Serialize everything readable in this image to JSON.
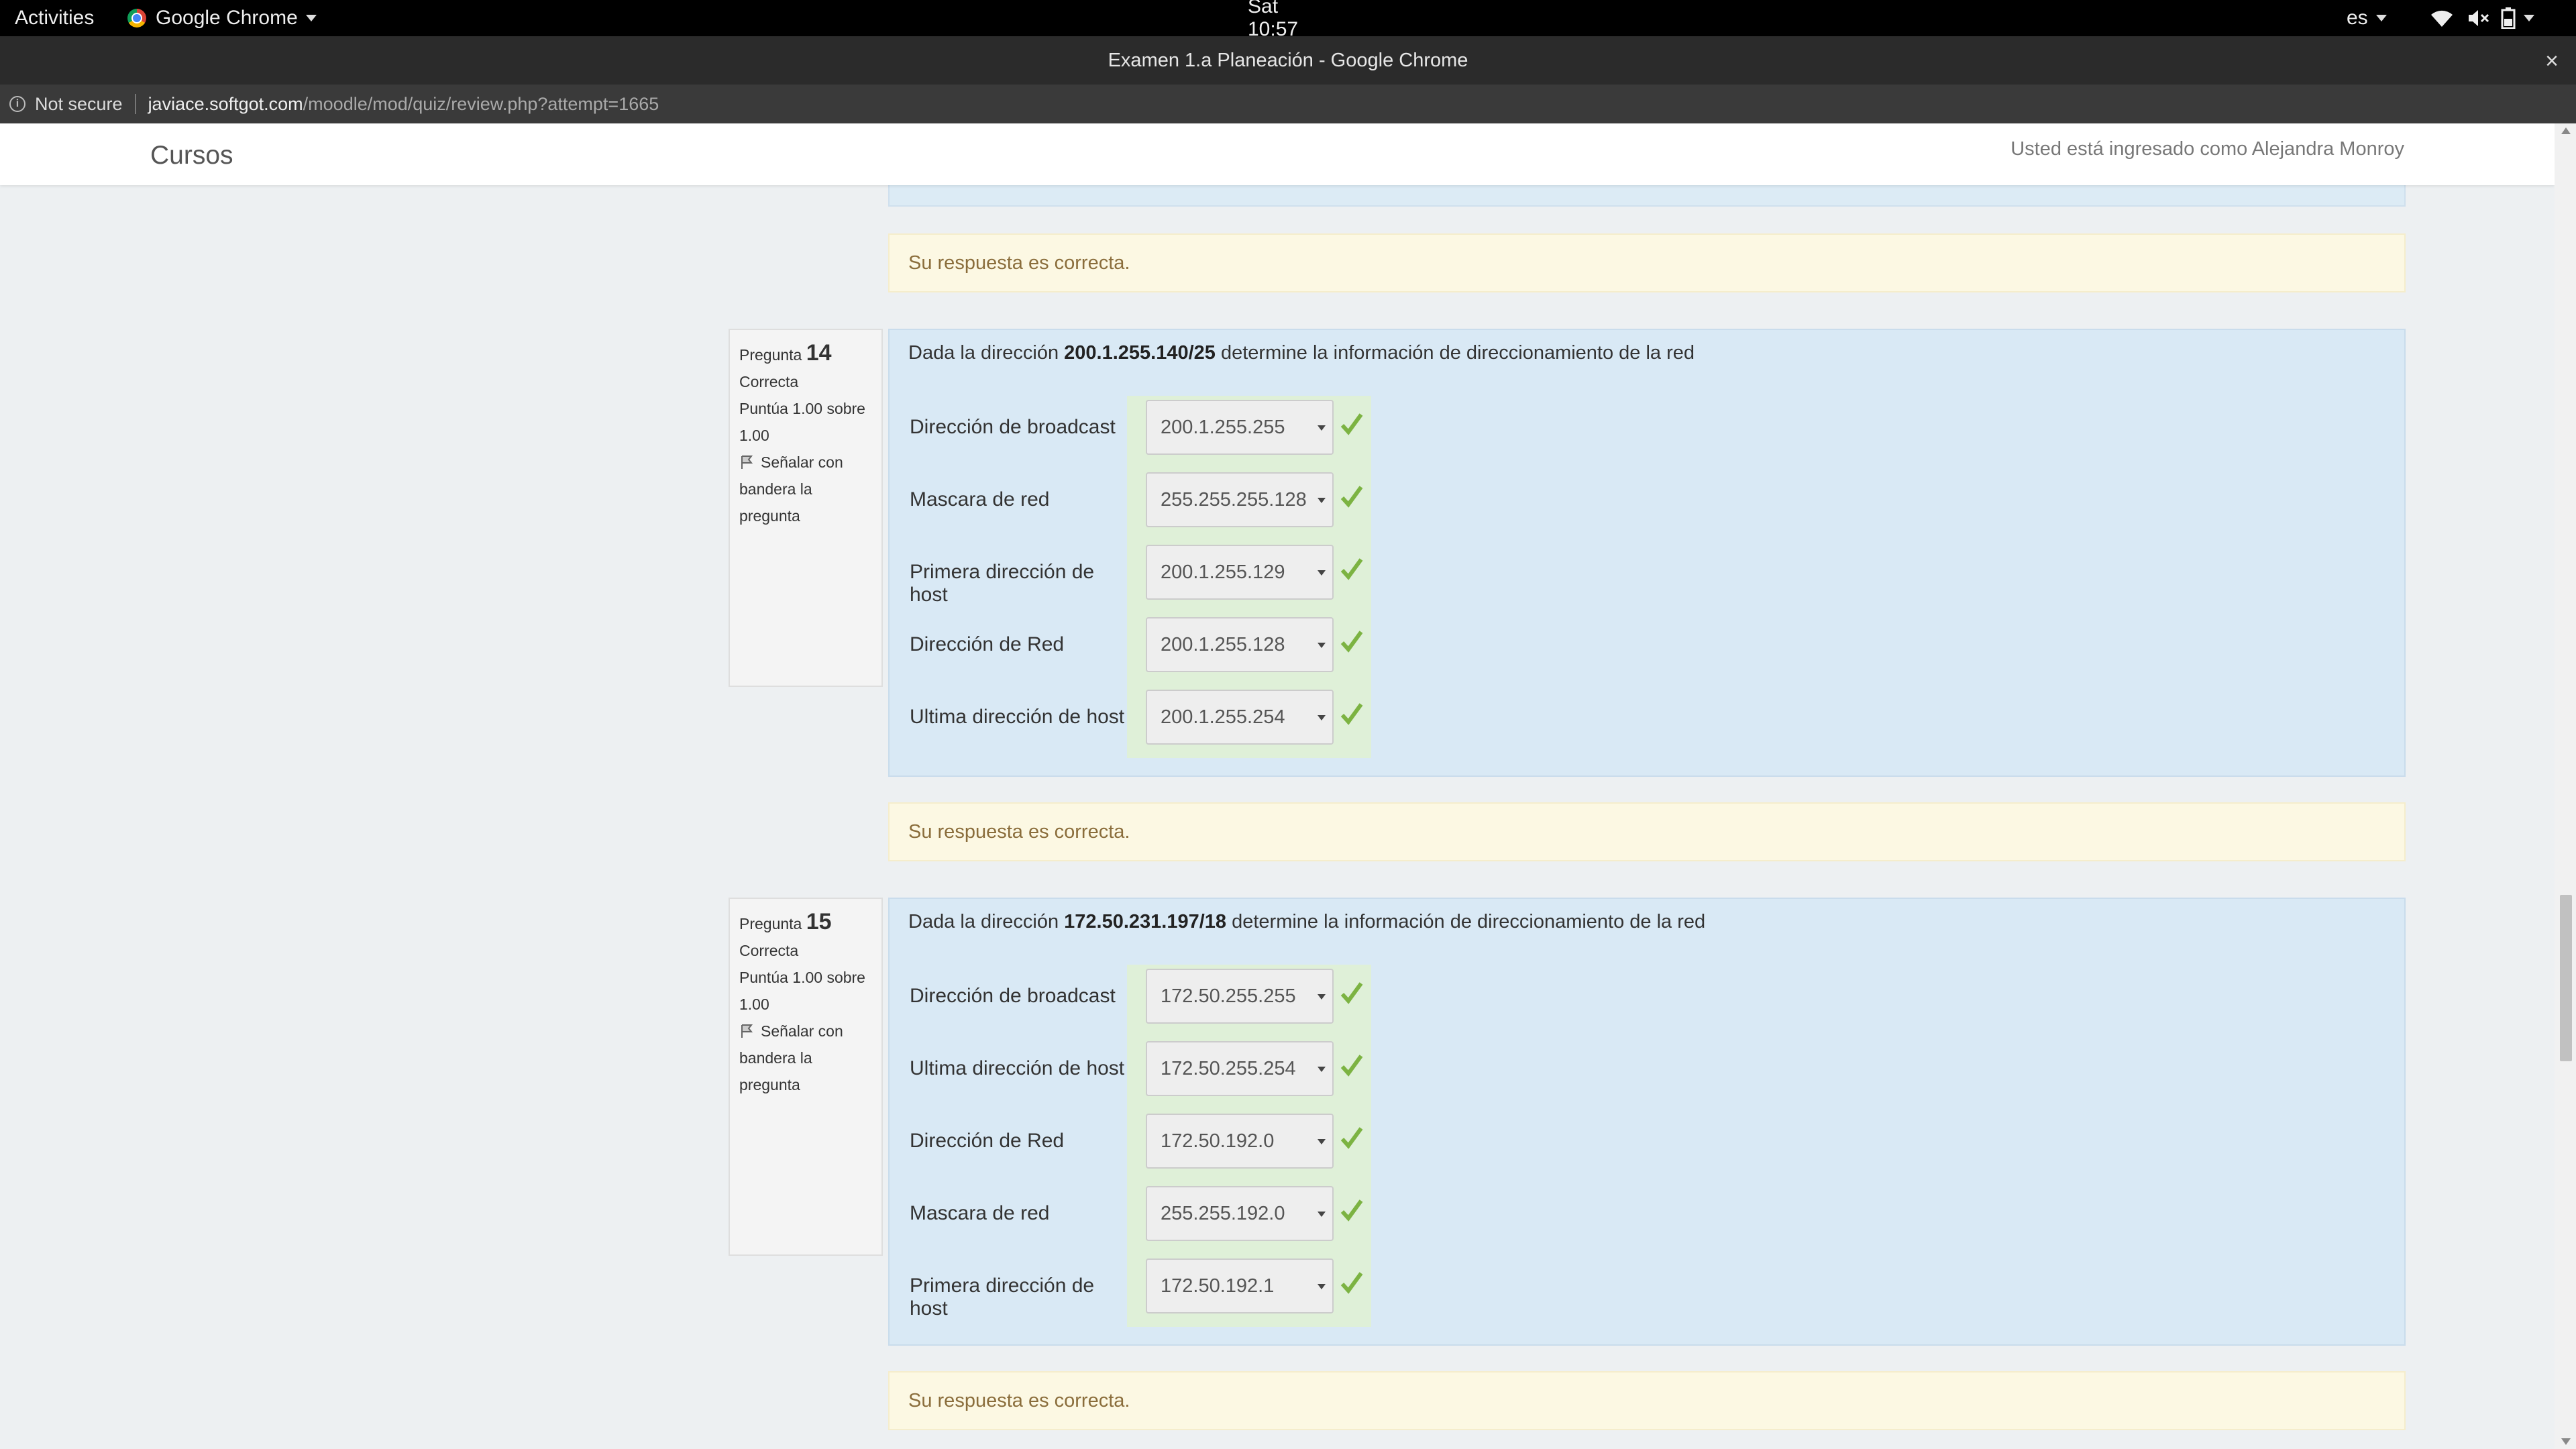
{
  "topbar": {
    "activities": "Activities",
    "app_name": "Google Chrome",
    "clock": "Sat 10:57",
    "lang": "es"
  },
  "window": {
    "title": "Examen 1.a Planeación - Google Chrome",
    "close": "×"
  },
  "addressbar": {
    "security": "Not secure",
    "url_host": "javiace.softgot.com",
    "url_path": "/moodle/mod/quiz/review.php?attempt=1665"
  },
  "navbar": {
    "brand": "Cursos",
    "login_text": "Usted está ingresado como Alejandra Monroy"
  },
  "feedback_text": "Su respuesta es correcta.",
  "questions": [
    {
      "prefix": "Pregunta",
      "number": "14",
      "state": "Correcta",
      "grade": "Puntúa 1.00 sobre 1.00",
      "flag_label": "Señalar con bandera la pregunta",
      "text_before": "Dada la dirección ",
      "address": "200.1.255.140/25",
      "text_after": " determine la información de direccionamiento de la red",
      "answers": [
        {
          "label": "Dirección de broadcast",
          "value": "200.1.255.255"
        },
        {
          "label": "Mascara de red",
          "value": "255.255.255.128"
        },
        {
          "label": "Primera dirección de host",
          "value": "200.1.255.129"
        },
        {
          "label": "Dirección de Red",
          "value": "200.1.255.128"
        },
        {
          "label": "Ultima dirección de host",
          "value": "200.1.255.254"
        }
      ]
    },
    {
      "prefix": "Pregunta",
      "number": "15",
      "state": "Correcta",
      "grade": "Puntúa 1.00 sobre 1.00",
      "flag_label": "Señalar con bandera la pregunta",
      "text_before": "Dada la dirección ",
      "address": "172.50.231.197/18",
      "text_after": " determine la información de direccionamiento de la red",
      "answers": [
        {
          "label": "Dirección de broadcast",
          "value": "172.50.255.255"
        },
        {
          "label": "Ultima dirección de host",
          "value": "172.50.255.254"
        },
        {
          "label": "Dirección de Red",
          "value": "172.50.192.0"
        },
        {
          "label": "Mascara de red",
          "value": "255.255.192.0"
        },
        {
          "label": "Primera dirección de host",
          "value": "172.50.192.1"
        }
      ]
    }
  ],
  "colors": {
    "question_bg": "#d9e9f5",
    "feedback_bg": "#fcf8e3",
    "correct_bg": "#dff0d8",
    "check": "#7cb342"
  }
}
